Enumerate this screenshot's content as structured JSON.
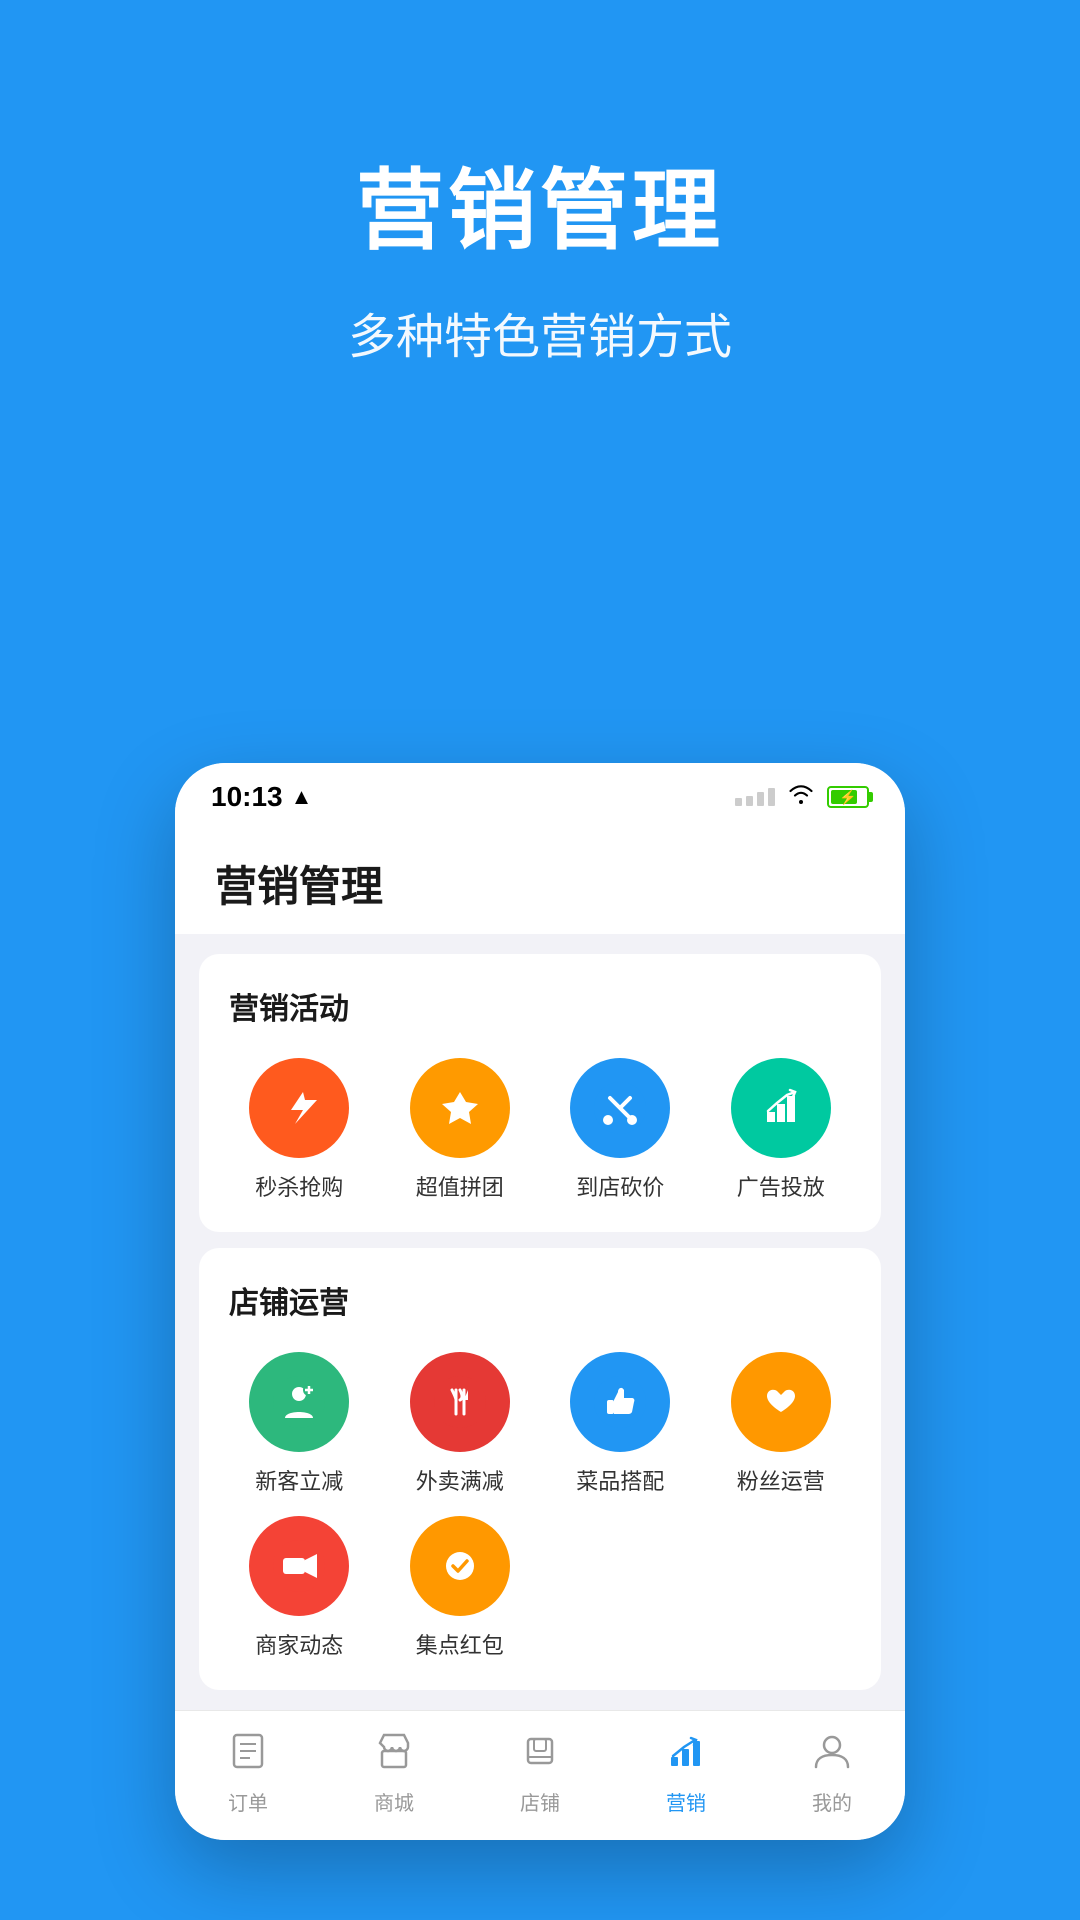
{
  "hero": {
    "title": "营销管理",
    "subtitle": "多种特色营销方式",
    "bg_color": "#2196F3"
  },
  "phone": {
    "status_bar": {
      "time": "10:13",
      "has_location": true
    },
    "app_header": {
      "title": "营销管理"
    },
    "sections": [
      {
        "title": "营销活动",
        "items": [
          {
            "id": "flash-sale",
            "label": "秒杀抢购",
            "color": "ic-red",
            "icon": "⚡"
          },
          {
            "id": "group-buy",
            "label": "超值拼团",
            "color": "ic-orange",
            "icon": "✦"
          },
          {
            "id": "in-store",
            "label": "到店砍价",
            "color": "ic-blue",
            "icon": "✂"
          },
          {
            "id": "ads",
            "label": "广告投放",
            "color": "ic-teal",
            "icon": "📊"
          }
        ]
      },
      {
        "title": "店铺运营",
        "items": [
          {
            "id": "new-discount",
            "label": "新客立减",
            "color": "ic-green",
            "icon": "👤"
          },
          {
            "id": "delivery",
            "label": "外卖满减",
            "color": "ic-red2",
            "icon": "🍴"
          },
          {
            "id": "combo",
            "label": "菜品搭配",
            "color": "ic-blue",
            "icon": "👍"
          },
          {
            "id": "fans",
            "label": "粉丝运营",
            "color": "ic-orange2",
            "icon": "♥"
          },
          {
            "id": "merchant",
            "label": "商家动态",
            "color": "ic-red3",
            "icon": "▶"
          },
          {
            "id": "points",
            "label": "集点红包",
            "color": "ic-orange2",
            "icon": "✓"
          }
        ]
      }
    ],
    "bottom_nav": [
      {
        "id": "orders",
        "label": "订单",
        "icon": "☰",
        "active": false
      },
      {
        "id": "mall",
        "label": "商城",
        "icon": "🛍",
        "active": false
      },
      {
        "id": "store",
        "label": "店铺",
        "icon": "🏪",
        "active": false
      },
      {
        "id": "marketing",
        "label": "营销",
        "icon": "📈",
        "active": true
      },
      {
        "id": "mine",
        "label": "我的",
        "icon": "👤",
        "active": false
      }
    ]
  }
}
